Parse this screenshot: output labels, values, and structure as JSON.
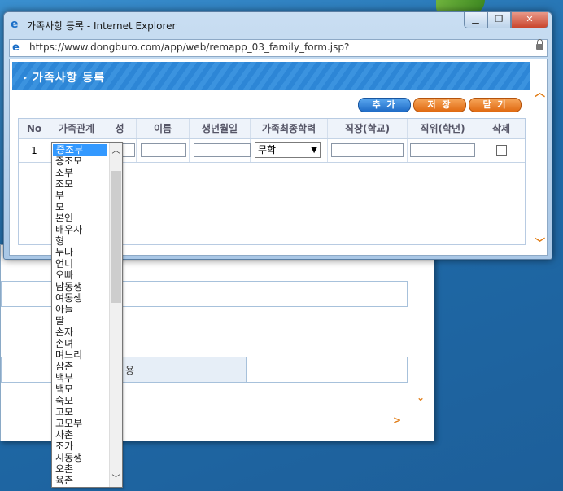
{
  "window": {
    "title": "가족사항 등록 - Internet Explorer",
    "url": "https://www.dongburo.com/app/web/remapp_03_family_form.jsp?",
    "controls": [
      "minimize",
      "restore",
      "close"
    ]
  },
  "page": {
    "header_title": "가족사항 등록",
    "buttons": {
      "add": "추 가",
      "save": "저 장",
      "close": "닫 기"
    },
    "table": {
      "columns": [
        "No",
        "가족관계",
        "성",
        "이름",
        "생년월일",
        "가족최종학력",
        "직장(학교)",
        "직위(학년)",
        "삭제"
      ],
      "rows": [
        {
          "no": "1",
          "relation": "증조부",
          "surname": "",
          "name": "",
          "birth": "",
          "education": "무학",
          "workplace": "",
          "position": "",
          "delete": false
        }
      ]
    }
  },
  "dropdown": {
    "selected": "증조부",
    "options": [
      "증조부",
      "증조모",
      "조부",
      "조모",
      "부",
      "모",
      "본인",
      "배우자",
      "형",
      "누나",
      "언니",
      "오빠",
      "남동생",
      "여동생",
      "아들",
      "딸",
      "손자",
      "손녀",
      "며느리",
      "삼촌",
      "백부",
      "백모",
      "숙모",
      "고모",
      "고모부",
      "사촌",
      "조카",
      "시동생",
      "오촌",
      "육촌"
    ]
  },
  "background_window": {
    "field_text": "용"
  },
  "icons": {
    "scroll_up": "^",
    "scroll_down": "v",
    "next": ">"
  }
}
